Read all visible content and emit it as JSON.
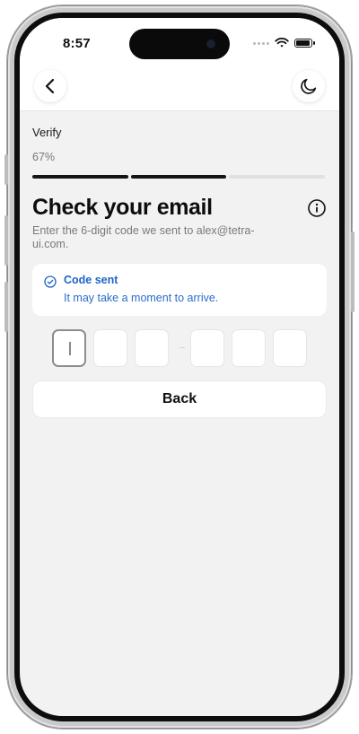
{
  "status_bar": {
    "time": "8:57"
  },
  "nav": {
    "back_icon": "chevron-left-icon",
    "theme_icon": "moon-icon"
  },
  "step": {
    "label": "Verify",
    "progress_text": "67%",
    "progress_fraction": 0.67
  },
  "heading": {
    "title": "Check your email",
    "subtitle": "Enter the 6-digit code we sent to alex@tetra-ui.com.",
    "info_icon": "info-icon"
  },
  "notice": {
    "icon": "check-circle-icon",
    "title": "Code sent",
    "body": "It may take a moment to arrive.",
    "color": "#1f63c6"
  },
  "otp": {
    "digits": [
      "",
      "",
      "",
      "",
      "",
      ""
    ],
    "active_index": 0
  },
  "actions": {
    "back_label": "Back"
  }
}
